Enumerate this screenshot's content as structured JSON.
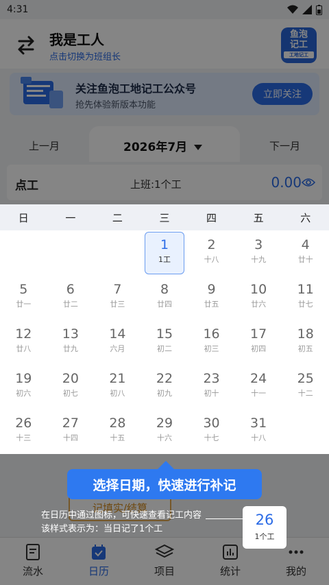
{
  "status": {
    "time": "4:31"
  },
  "header": {
    "title": "我是工人",
    "subtitle": "点击切换为班组长",
    "logo_line1": "鱼泡",
    "logo_line2": "记工",
    "logo_small": "工地记工"
  },
  "banner": {
    "title": "关注鱼泡工地记工公众号",
    "subtitle": "抢先体验新版本功能",
    "button": "立即关注"
  },
  "month_nav": {
    "prev": "上一月",
    "current": "2026年7月",
    "next": "下一月"
  },
  "summary": {
    "label": "点工",
    "detail": "上班:1个工",
    "amount": "0.00"
  },
  "calendar": {
    "weekdays": [
      "日",
      "一",
      "二",
      "三",
      "四",
      "五",
      "六"
    ],
    "weeks": [
      [
        {
          "d": "",
          "l": ""
        },
        {
          "d": "",
          "l": ""
        },
        {
          "d": "",
          "l": ""
        },
        {
          "d": "1",
          "l": "1工",
          "selected": true
        },
        {
          "d": "2",
          "l": "十八"
        },
        {
          "d": "3",
          "l": "十九"
        },
        {
          "d": "4",
          "l": "廿十"
        }
      ],
      [
        {
          "d": "5",
          "l": "廿一"
        },
        {
          "d": "6",
          "l": "廿二"
        },
        {
          "d": "7",
          "l": "廿三"
        },
        {
          "d": "8",
          "l": "廿四"
        },
        {
          "d": "9",
          "l": "廿五"
        },
        {
          "d": "10",
          "l": "廿六"
        },
        {
          "d": "11",
          "l": "廿七"
        }
      ],
      [
        {
          "d": "12",
          "l": "廿八"
        },
        {
          "d": "13",
          "l": "廿九"
        },
        {
          "d": "14",
          "l": "六月"
        },
        {
          "d": "15",
          "l": "初二"
        },
        {
          "d": "16",
          "l": "初三"
        },
        {
          "d": "17",
          "l": "初四"
        },
        {
          "d": "18",
          "l": "初五"
        }
      ],
      [
        {
          "d": "19",
          "l": "初六"
        },
        {
          "d": "20",
          "l": "初七"
        },
        {
          "d": "21",
          "l": "初八"
        },
        {
          "d": "22",
          "l": "初九"
        },
        {
          "d": "23",
          "l": "初十"
        },
        {
          "d": "24",
          "l": "十一"
        },
        {
          "d": "25",
          "l": "十二"
        }
      ],
      [
        {
          "d": "26",
          "l": "十三"
        },
        {
          "d": "27",
          "l": "十四"
        },
        {
          "d": "28",
          "l": "十五"
        },
        {
          "d": "29",
          "l": "十六"
        },
        {
          "d": "30",
          "l": "十七"
        },
        {
          "d": "31",
          "l": "十八"
        },
        {
          "d": "",
          "l": ""
        }
      ]
    ]
  },
  "record_button": "记填实/结算",
  "tip": {
    "title": "选择日期，快速进行补记",
    "line1": "在日历中通过图标，可快速查看记工内容",
    "line2": "该样式表示为：当日记了1个工",
    "example_day": "26",
    "example_label": "1个工"
  },
  "bottom_nav": [
    {
      "label": "流水",
      "icon": "ledger-icon"
    },
    {
      "label": "日历",
      "icon": "calendar-icon",
      "active": true
    },
    {
      "label": "项目",
      "icon": "layers-icon"
    },
    {
      "label": "统计",
      "icon": "chart-icon"
    },
    {
      "label": "我的",
      "icon": "more-icon"
    }
  ],
  "colors": {
    "accent": "#2b6be6",
    "tip": "#2e79f0",
    "overlay": "rgba(0,0,0,0.48)"
  }
}
